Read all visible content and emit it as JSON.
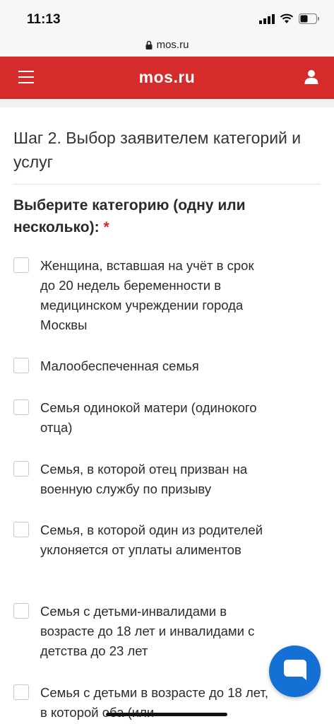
{
  "status_bar": {
    "time": "11:13"
  },
  "browser": {
    "url": "mos.ru"
  },
  "header": {
    "title": "mos.ru"
  },
  "form": {
    "step_title": "Шаг 2. Выбор заявителем категорий и услуг",
    "question": "Выберите категорию (одну или несколько):",
    "required_mark": "*",
    "options": [
      {
        "label": "Женщина, вставшая на учёт в срок до 20 недель беременности в медицинском учреждении города Москвы",
        "checked": false
      },
      {
        "label": "Малообеспеченная семья",
        "checked": false
      },
      {
        "label": "Семья одинокой матери (одинокого отца)",
        "checked": false
      },
      {
        "label": "Семья, в которой отец призван на военную службу по призыву",
        "checked": false
      },
      {
        "label": "Семья, в которой один из родителей уклоняется от уплаты алиментов",
        "checked": false
      },
      {
        "label": "Семья с детьми-инвалидами в возрасте до 18 лет и инвалидами с детства до 23 лет",
        "checked": false
      },
      {
        "label": "Семья с детьми в возрасте до 18 лет, в которой оба (или",
        "checked": false
      }
    ]
  },
  "colors": {
    "brand_red": "#d52b2b",
    "chat_blue": "#1570d6"
  }
}
